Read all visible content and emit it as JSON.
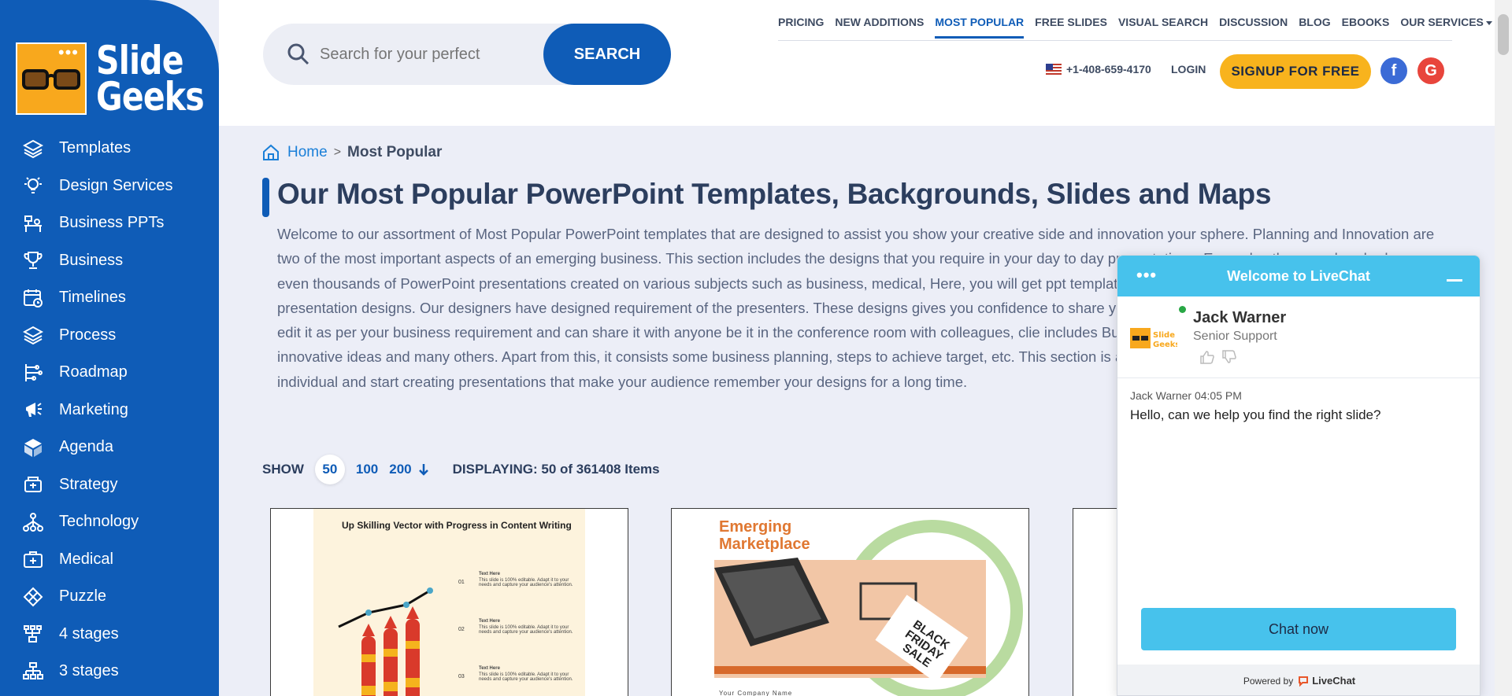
{
  "brand": {
    "name_line1": "Slide",
    "name_line2": "Geeks"
  },
  "sidebar": {
    "items": [
      {
        "label": "Templates",
        "icon": "layers-icon"
      },
      {
        "label": "Design Services",
        "icon": "lightbulb-icon"
      },
      {
        "label": "Business PPTs",
        "icon": "desk-icon"
      },
      {
        "label": "Business",
        "icon": "trophy-icon"
      },
      {
        "label": "Timelines",
        "icon": "calendar-clock-icon"
      },
      {
        "label": "Process",
        "icon": "layers-icon"
      },
      {
        "label": "Roadmap",
        "icon": "roadmap-icon"
      },
      {
        "label": "Marketing",
        "icon": "megaphone-icon"
      },
      {
        "label": "Agenda",
        "icon": "cube-icon"
      },
      {
        "label": "Strategy",
        "icon": "strategy-icon"
      },
      {
        "label": "Technology",
        "icon": "network-icon"
      },
      {
        "label": "Medical",
        "icon": "medical-kit-icon"
      },
      {
        "label": "Puzzle",
        "icon": "puzzle-icon"
      },
      {
        "label": "4 stages",
        "icon": "hierarchy-icon"
      },
      {
        "label": "3 stages",
        "icon": "hierarchy-icon"
      }
    ]
  },
  "search": {
    "placeholder": "Search for your perfect",
    "button": "SEARCH"
  },
  "topnav": {
    "items": [
      "PRICING",
      "NEW ADDITIONS",
      "MOST POPULAR",
      "FREE SLIDES",
      "VISUAL SEARCH",
      "DISCUSSION",
      "BLOG",
      "EBOOKS",
      "OUR SERVICES"
    ],
    "active": "MOST POPULAR"
  },
  "header": {
    "phone": "+1-408-659-4170",
    "login": "LOGIN",
    "signup": "SIGNUP FOR FREE",
    "fb": "f",
    "google": "G"
  },
  "breadcrumb": {
    "home": "Home",
    "separator": ">",
    "current": "Most Popular"
  },
  "page": {
    "title": "Our Most Popular PowerPoint Templates, Backgrounds, Slides and Maps",
    "intro": "Welcome to our assortment of Most Popular PowerPoint templates that are designed to assist you show your creative side and innovation your sphere. Planning and Innovation are two of the most important aspects of an emerging business. This section includes the designs that you require in your day to day presentations. Every day there are hundreds or even thousands of PowerPoint presentations created on various subjects such as business, medical, Here, you will get ppt templates as well as themes to create impressive presentation designs. Our designers have designed requirement of the presenters. These designs gives you confidence to share your presentation slides without being worried it, edit it as per your business requirement and can share it with anyone be it in the conference room with colleagues, clie includes Business meeting board room, illustration of innovative ideas and many others. Apart from this, it consists some business planning, steps to achieve target, etc. This section is a complete gallery of designs that can attract any individual and start creating presentations that make your audience remember your designs for a long time."
  },
  "listing": {
    "show_label": "SHOW",
    "options": [
      "50",
      "100",
      "200"
    ],
    "selected": "50",
    "displaying": "DISPLAYING: 50 of 361408 Items"
  },
  "cards": {
    "card1": {
      "title": "Up Skilling Vector with Progress in Content Writing",
      "items": [
        {
          "num": "01",
          "heading": "Text Here",
          "body": "This slide is 100% editable. Adapt it to your needs and capture your audience's attention."
        },
        {
          "num": "02",
          "heading": "Text Here",
          "body": "This slide is 100% editable. Adapt it to your needs and capture your audience's attention."
        },
        {
          "num": "03",
          "heading": "Text Here",
          "body": "This slide is 100% editable. Adapt it to your needs and capture your audience's attention."
        }
      ]
    },
    "card2": {
      "title_line1": "Emerging",
      "title_line2": "Marketplace",
      "sign_text": "BLACK FRIDAY SALE",
      "company": "Your Company Name"
    }
  },
  "chat": {
    "header": "Welcome to LiveChat",
    "agent_name": "Jack Warner",
    "agent_role": "Senior Support",
    "message_meta": "Jack Warner 04:05 PM",
    "message": "Hello, can we help you find the right slide?",
    "cta": "Chat now",
    "powered_by": "Powered by",
    "powered_brand": "LiveChat"
  },
  "colors": {
    "brand_blue": "#0f5cb7",
    "accent_yellow": "#f8b31d",
    "chat_blue": "#47c2ec"
  }
}
